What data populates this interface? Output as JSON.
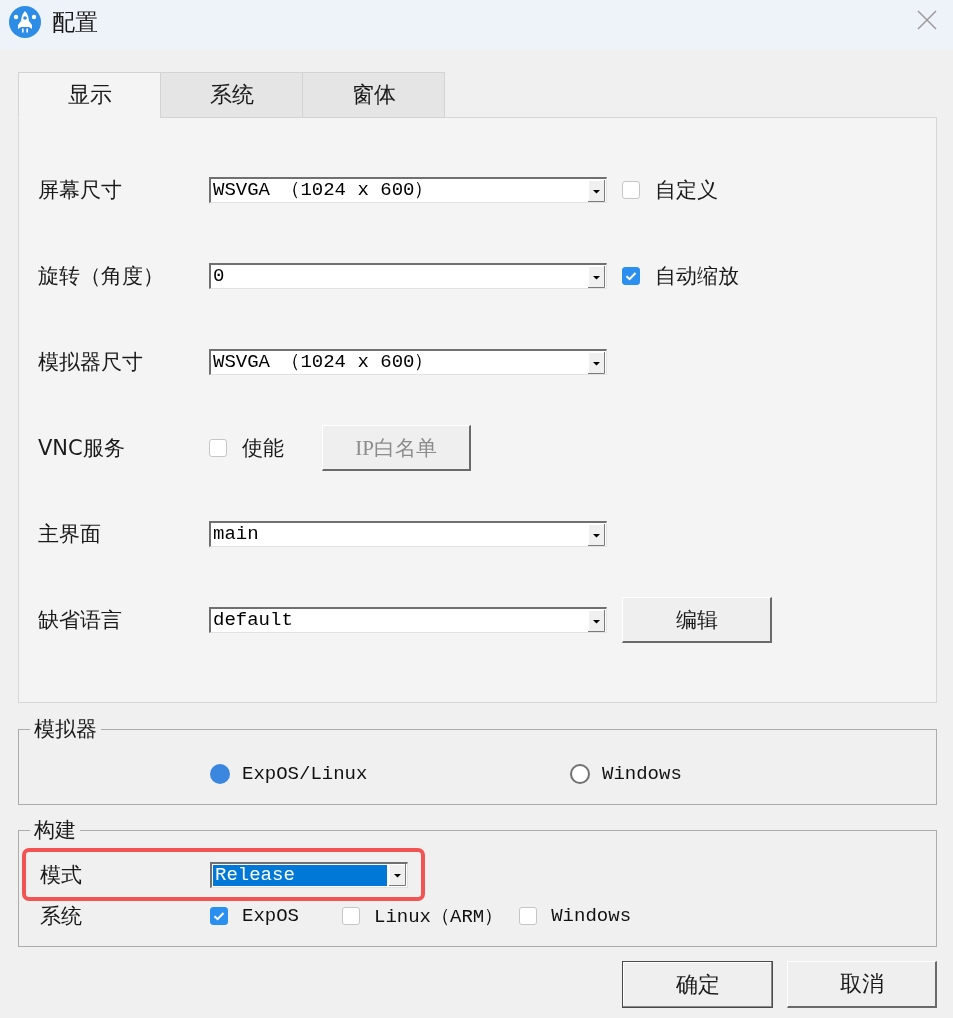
{
  "window": {
    "title": "配置"
  },
  "tabs": [
    {
      "label": "显示",
      "selected": true
    },
    {
      "label": "系统",
      "selected": false
    },
    {
      "label": "窗体",
      "selected": false
    }
  ],
  "display_settings": [
    {
      "kind": "combo",
      "label": "屏幕尺寸",
      "value": "WSVGA （1024 x 600）",
      "option": {
        "label": "自定义",
        "checked": false
      }
    },
    {
      "kind": "combo",
      "label": "旋转（角度）",
      "value": "0",
      "option": {
        "label": "自动缩放",
        "checked": true
      }
    },
    {
      "kind": "combo",
      "label": "模拟器尺寸",
      "value": "WSVGA （1024 x 600）"
    },
    {
      "kind": "toggle",
      "label": "VNC服务",
      "option": {
        "label": "使能",
        "checked": false
      },
      "button": {
        "label": "IP白名单",
        "disabled": true
      }
    },
    {
      "kind": "combo",
      "label": "主界面",
      "value": "main"
    },
    {
      "kind": "combo",
      "label": "缺省语言",
      "value": "default",
      "button": {
        "label": "编辑",
        "disabled": false
      }
    }
  ],
  "simulator_group": {
    "title": "模拟器",
    "options": [
      {
        "label": "ExpOS/Linux",
        "selected": true
      },
      {
        "label": "Windows",
        "selected": false
      }
    ]
  },
  "build_group": {
    "title": "构建",
    "mode": {
      "label": "模式",
      "value": "Release",
      "focused": true,
      "highlighted": true
    },
    "system": {
      "label": "系统",
      "options": [
        {
          "label": "ExpOS",
          "checked": true
        },
        {
          "label": "Linux（ARM）",
          "checked": false
        },
        {
          "label": "Windows",
          "checked": false
        }
      ]
    }
  },
  "buttons": [
    {
      "label": "确定",
      "default": true
    },
    {
      "label": "取消",
      "default": false
    }
  ]
}
